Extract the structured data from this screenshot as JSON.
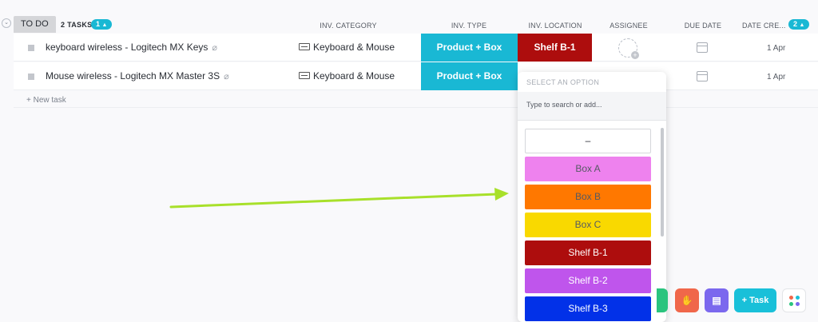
{
  "group": {
    "status_label": "TO DO",
    "task_count_label": "2 TASKS",
    "badge_left": "1",
    "badge_right": "2"
  },
  "columns": {
    "category": "INV. CATEGORY",
    "type": "INV. TYPE",
    "location": "INV. LOCATION",
    "assignee": "ASSIGNEE",
    "due_date": "DUE DATE",
    "date_created": "DATE CRE..."
  },
  "rows": [
    {
      "name": "keyboard wireless - Logitech MX Keys",
      "category": "Keyboard & Mouse",
      "type": "Product + Box",
      "location": "Shelf B-1",
      "date_created": "1 Apr"
    },
    {
      "name": "Mouse wireless - Logitech MX Master 3S",
      "category": "Keyboard & Mouse",
      "type": "Product + Box",
      "location": "",
      "date_created": "1 Apr"
    }
  ],
  "new_task_label": "+ New task",
  "dropdown": {
    "title": "SELECT AN OPTION",
    "search_placeholder": "Type to search or add...",
    "options": [
      {
        "label": "–",
        "color": "#ffffff",
        "text_color": "#292d34"
      },
      {
        "label": "Box A",
        "color": "#ee82ee",
        "text_color": "#555a63"
      },
      {
        "label": "Box B",
        "color": "#ff7800",
        "text_color": "#555a63"
      },
      {
        "label": "Box C",
        "color": "#f9d900",
        "text_color": "#555a63"
      },
      {
        "label": "Shelf B-1",
        "color": "#ad0d0d",
        "text_color": "#ffffff"
      },
      {
        "label": "Shelf B-2",
        "color": "#bf55ec",
        "text_color": "#ffffff"
      },
      {
        "label": "Shelf B-3",
        "color": "#0231e8",
        "text_color": "#ffffff"
      }
    ]
  },
  "actions": {
    "task_label": "+ Task"
  },
  "colors": {
    "accent": "#19b8d4",
    "arrow": "#a8e02a"
  }
}
